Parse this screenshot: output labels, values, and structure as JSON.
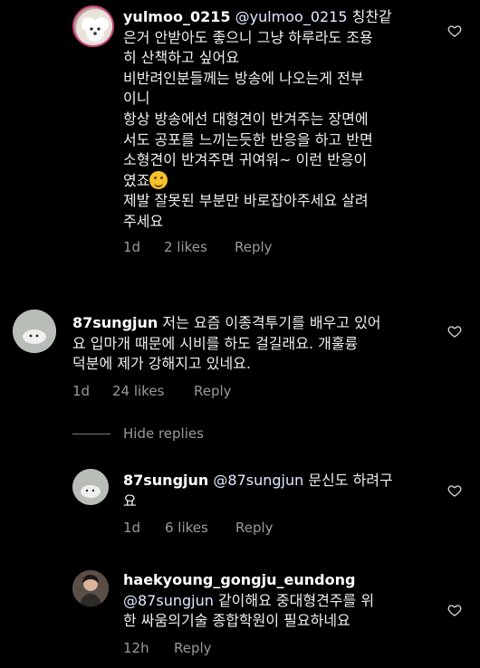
{
  "comments": [
    {
      "username": "yulmoo_0215",
      "mention": "@yulmoo_0215",
      "text_lines": [
        " 칭찬같",
        "은거 안받아도 좋으니 그냥 하루라도 조용",
        "히 산책하고 싶어요",
        "비반려인분들께는 방송에 나오는게 전부",
        "이니",
        "항상 방송에선 대형견이 반겨주는 장면에",
        "서도 공포를 느끼는듯한 반응을 하고 반면",
        "소형견이 반겨주면 귀여워~ 이런 반응이",
        "였죠"
      ],
      "text_end_lines": [
        "제발 잘못된 부분만 바로잡아주세요 살려",
        "주세요"
      ],
      "emoji": "grinning-sweat-emoji",
      "time": "1d",
      "likes": "2 likes",
      "reply": "Reply"
    },
    {
      "username": "87sungjun",
      "text_lines": [
        " 저는 요즘 이종격투기를 배우고 있어",
        "요 입마개 때문에 시비를 하도 걸길래요. 개훌륭",
        "덕분에 제가 강해지고 있네요."
      ],
      "time": "1d",
      "likes": "24 likes",
      "reply": "Reply"
    },
    {
      "username": "87sungjun",
      "mention": "@87sungjun",
      "text_lines": [
        " 문신도 하려구",
        "요"
      ],
      "time": "1d",
      "likes": "6 likes",
      "reply": "Reply"
    },
    {
      "username": "haekyoung_gongju_eundong",
      "mention": "@87sungjun",
      "text_lines": [
        " 같이해요 중대형견주를 위",
        "한 싸움의기술 종합학원이 필요하네요"
      ],
      "time": "12h",
      "reply": "Reply"
    }
  ],
  "hide_replies": "Hide replies",
  "colors": {
    "background": "#000000",
    "text": "#efefef",
    "meta": "#9a9a9a"
  }
}
